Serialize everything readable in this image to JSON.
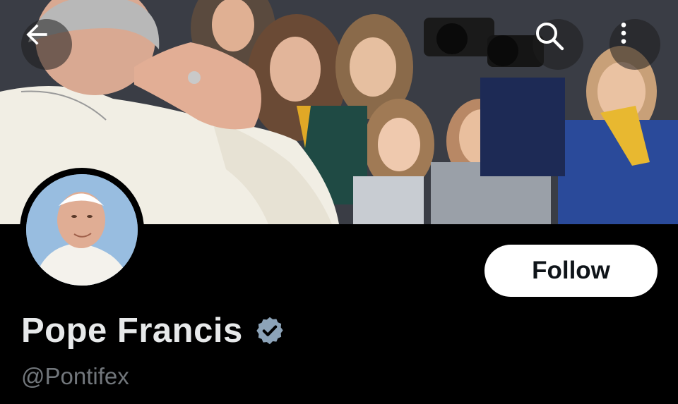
{
  "header": {
    "back_icon": "arrow-left-icon",
    "search_icon": "search-icon",
    "more_icon": "more-vertical-icon"
  },
  "profile": {
    "display_name": "Pope Francis",
    "handle": "@Pontifex",
    "verified_icon": "verified-badge-icon",
    "verified_color": "#8ca3b8",
    "follow_label": "Follow"
  },
  "colors": {
    "background": "#000000",
    "name_text": "#e7e9ea",
    "handle_text": "#71767b",
    "button_bg": "#ffffff",
    "button_text": "#0f1419"
  }
}
